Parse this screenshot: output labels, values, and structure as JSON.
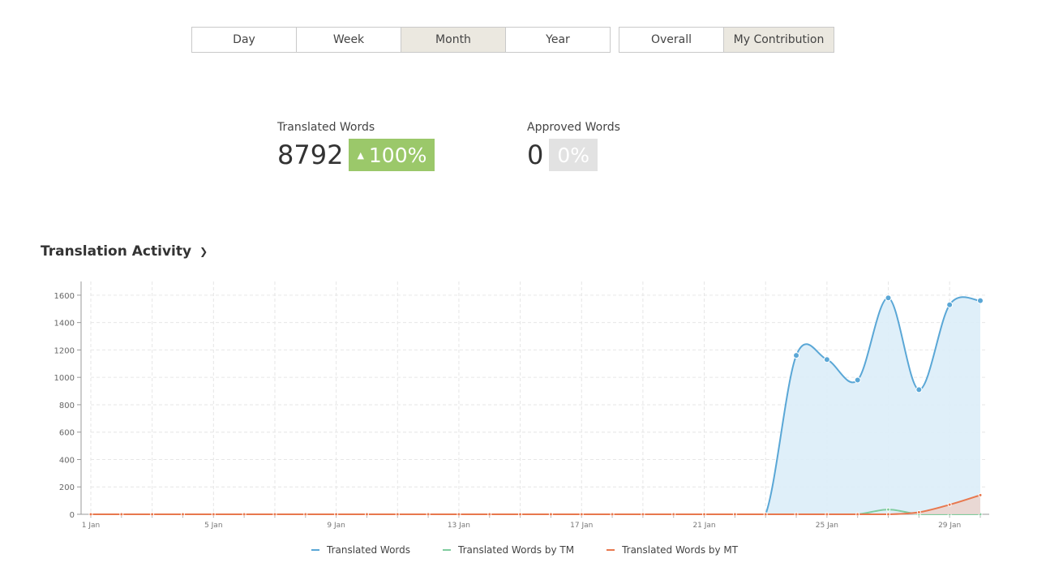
{
  "period_buttons": [
    {
      "label": "Day",
      "active": false
    },
    {
      "label": "Week",
      "active": false
    },
    {
      "label": "Month",
      "active": true
    },
    {
      "label": "Year",
      "active": false
    }
  ],
  "scope_buttons": [
    {
      "label": "Overall",
      "active": false
    },
    {
      "label": "My Contribution",
      "active": true
    }
  ],
  "stats": {
    "translated": {
      "label": "Translated Words",
      "value": "8792",
      "change": "100%"
    },
    "approved": {
      "label": "Approved Words",
      "value": "0",
      "change": "0%"
    }
  },
  "chart_section": {
    "title": "Translation Activity",
    "toggle_icon": "chevron-down-icon"
  },
  "chart_data": {
    "type": "area",
    "x": [
      1,
      2,
      3,
      4,
      5,
      6,
      7,
      8,
      9,
      10,
      11,
      12,
      13,
      14,
      15,
      16,
      17,
      18,
      19,
      20,
      21,
      22,
      23,
      24,
      25,
      26,
      27,
      28,
      29,
      30
    ],
    "x_ticks": [
      1,
      5,
      9,
      13,
      17,
      21,
      25,
      29
    ],
    "x_tick_labels": [
      "1 Jan",
      "5 Jan",
      "9 Jan",
      "13 Jan",
      "17 Jan",
      "21 Jan",
      "25 Jan",
      "29 Jan"
    ],
    "ylim": [
      0,
      1700
    ],
    "y_ticks": [
      0,
      200,
      400,
      600,
      800,
      1000,
      1200,
      1400,
      1600
    ],
    "grid": true,
    "legend_position": "bottom",
    "series": [
      {
        "name": "Translated Words",
        "color": "#5aa7d6",
        "fill": "#dcedf8",
        "values": [
          0,
          0,
          0,
          0,
          0,
          0,
          0,
          0,
          0,
          0,
          0,
          0,
          0,
          0,
          0,
          0,
          0,
          0,
          0,
          0,
          0,
          0,
          0,
          1160,
          1130,
          980,
          1580,
          910,
          1530,
          1560
        ]
      },
      {
        "name": "Translated Words by TM",
        "color": "#7fcc9e",
        "fill": "none",
        "values": [
          0,
          0,
          0,
          0,
          0,
          0,
          0,
          0,
          0,
          0,
          0,
          0,
          0,
          0,
          0,
          0,
          0,
          0,
          0,
          0,
          0,
          0,
          0,
          0,
          0,
          0,
          35,
          0,
          0,
          0
        ]
      },
      {
        "name": "Translated Words by MT",
        "color": "#e8784e",
        "fill": "#ead5cf",
        "values": [
          0,
          0,
          0,
          0,
          0,
          0,
          0,
          0,
          0,
          0,
          0,
          0,
          0,
          0,
          0,
          0,
          0,
          0,
          0,
          0,
          0,
          0,
          0,
          0,
          0,
          0,
          0,
          15,
          70,
          140
        ]
      }
    ]
  }
}
